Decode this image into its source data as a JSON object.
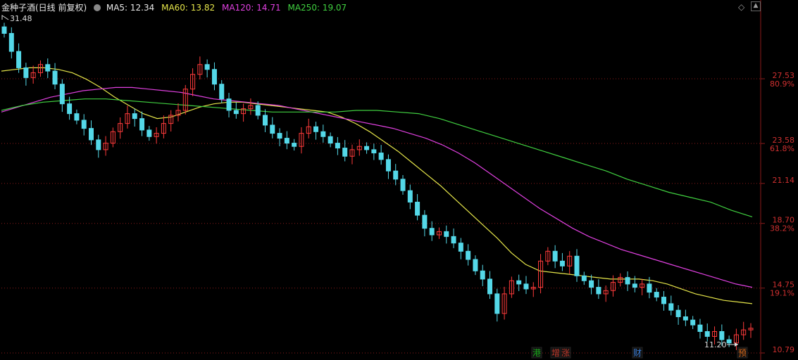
{
  "header": {
    "title": "金种子酒(日线 前复权)",
    "ma_items": [
      {
        "label": "MA5: 12.34",
        "color": "#e8e8e8"
      },
      {
        "label": "MA60: 13.82",
        "color": "#e6e64a"
      },
      {
        "label": "MA120: 14.71",
        "color": "#e040e0"
      },
      {
        "label": "MA250: 19.07",
        "color": "#40d040"
      }
    ],
    "dropdown_icon": "circle-down-icon",
    "right_controls": [
      "diamond-icon",
      "scroll-up-icon"
    ]
  },
  "chart_data": {
    "type": "candlestick",
    "y_ticks": [
      {
        "value": 27.53,
        "label": "27.53",
        "pct": "80.9%"
      },
      {
        "value": 23.58,
        "label": "23.58",
        "pct": "61.8%"
      },
      {
        "value": 21.14,
        "label": "21.14",
        "pct": ""
      },
      {
        "value": 18.7,
        "label": "18.70",
        "pct": "38.2%"
      },
      {
        "value": 14.75,
        "label": "14.75",
        "pct": "19.1%"
      },
      {
        "value": 10.79,
        "label": "10.79",
        "pct": ""
      }
    ],
    "ylim": [
      10.79,
      31.48
    ],
    "grid": "dotted-horizontal",
    "high_label": "31.48",
    "low_label": "11.20",
    "close_path": [
      30.3,
      29.2,
      28.2,
      27.6,
      27.9,
      28.4,
      28.0,
      27.2,
      26.0,
      25.4,
      25.0,
      24.5,
      23.8,
      23.2,
      23.6,
      24.3,
      24.8,
      25.4,
      25.1,
      24.4,
      24.0,
      24.2,
      24.8,
      25.3,
      25.6,
      26.9,
      27.8,
      28.4,
      28.1,
      27.2,
      26.3,
      25.6,
      25.4,
      25.7,
      25.9,
      25.3,
      24.7,
      24.2,
      23.9,
      23.6,
      23.4,
      24.2,
      24.6,
      24.3,
      24.0,
      23.6,
      23.3,
      22.8,
      23.2,
      23.4,
      23.2,
      23.0,
      22.6,
      21.9,
      21.4,
      20.7,
      20.0,
      19.2,
      18.4,
      18.0,
      18.2,
      17.9,
      17.5,
      17.0,
      16.5,
      15.8,
      15.3,
      14.4,
      13.2,
      14.4,
      15.2,
      15.0,
      14.7,
      14.8,
      16.4,
      17.0,
      16.4,
      16.1,
      16.7,
      15.5,
      15.2,
      14.8,
      14.4,
      14.6,
      15.1,
      15.4,
      15.0,
      14.8,
      15.0,
      14.5,
      14.2,
      13.8,
      13.4,
      13.0,
      12.8,
      12.5,
      12.1,
      11.8,
      12.1,
      11.6,
      11.4,
      11.9,
      12.2,
      12.3
    ],
    "series": [
      {
        "name": "MA60",
        "color": "#e6e64a",
        "values": [
          28.0,
          28.1,
          28.2,
          28.2,
          28.1,
          27.9,
          27.5,
          27.0,
          26.4,
          25.9,
          25.4,
          25.1,
          25.2,
          25.5,
          25.8,
          26.0,
          26.1,
          26.1,
          26.0,
          25.9,
          25.8,
          25.7,
          25.6,
          25.5,
          25.2,
          24.8,
          24.3,
          23.7,
          23.1,
          22.4,
          21.7,
          21.0,
          20.2,
          19.4,
          18.6,
          17.8,
          16.9,
          16.2,
          15.8,
          15.7,
          15.6,
          15.5,
          15.4,
          15.3,
          15.3,
          15.3,
          15.2,
          15.0,
          14.7,
          14.4,
          14.2,
          14.0,
          13.9,
          13.8
        ]
      },
      {
        "name": "MA120",
        "color": "#e040e0",
        "values": [
          25.5,
          25.8,
          26.1,
          26.4,
          26.6,
          26.8,
          26.9,
          27.0,
          27.0,
          26.9,
          26.8,
          26.7,
          26.5,
          26.3,
          26.2,
          26.1,
          26.0,
          25.9,
          25.7,
          25.5,
          25.3,
          25.1,
          24.9,
          24.7,
          24.5,
          24.2,
          23.9,
          23.5,
          23.0,
          22.4,
          21.7,
          21.0,
          20.3,
          19.6,
          19.0,
          18.4,
          17.9,
          17.5,
          17.1,
          16.8,
          16.5,
          16.2,
          15.9,
          15.6,
          15.3,
          15.0,
          14.8
        ]
      },
      {
        "name": "MA250",
        "color": "#40d040",
        "values": [
          25.6,
          25.9,
          26.1,
          26.2,
          26.3,
          26.3,
          26.2,
          26.1,
          26.0,
          25.9,
          25.8,
          25.7,
          25.6,
          25.5,
          25.5,
          25.5,
          25.5,
          25.6,
          25.6,
          25.5,
          25.4,
          25.1,
          24.7,
          24.3,
          23.9,
          23.5,
          23.1,
          22.7,
          22.3,
          21.9,
          21.4,
          21.0,
          20.6,
          20.3,
          20.0,
          19.5,
          19.1
        ]
      }
    ],
    "markers": [
      {
        "label": "港",
        "color": "#1aa81a"
      },
      {
        "label": "增",
        "color": "#c0392b"
      },
      {
        "label": "涨",
        "color": "#c0392b"
      },
      {
        "label": "财",
        "color": "#3a7bd5"
      },
      {
        "label": "预",
        "color": "#d4661a"
      }
    ]
  }
}
